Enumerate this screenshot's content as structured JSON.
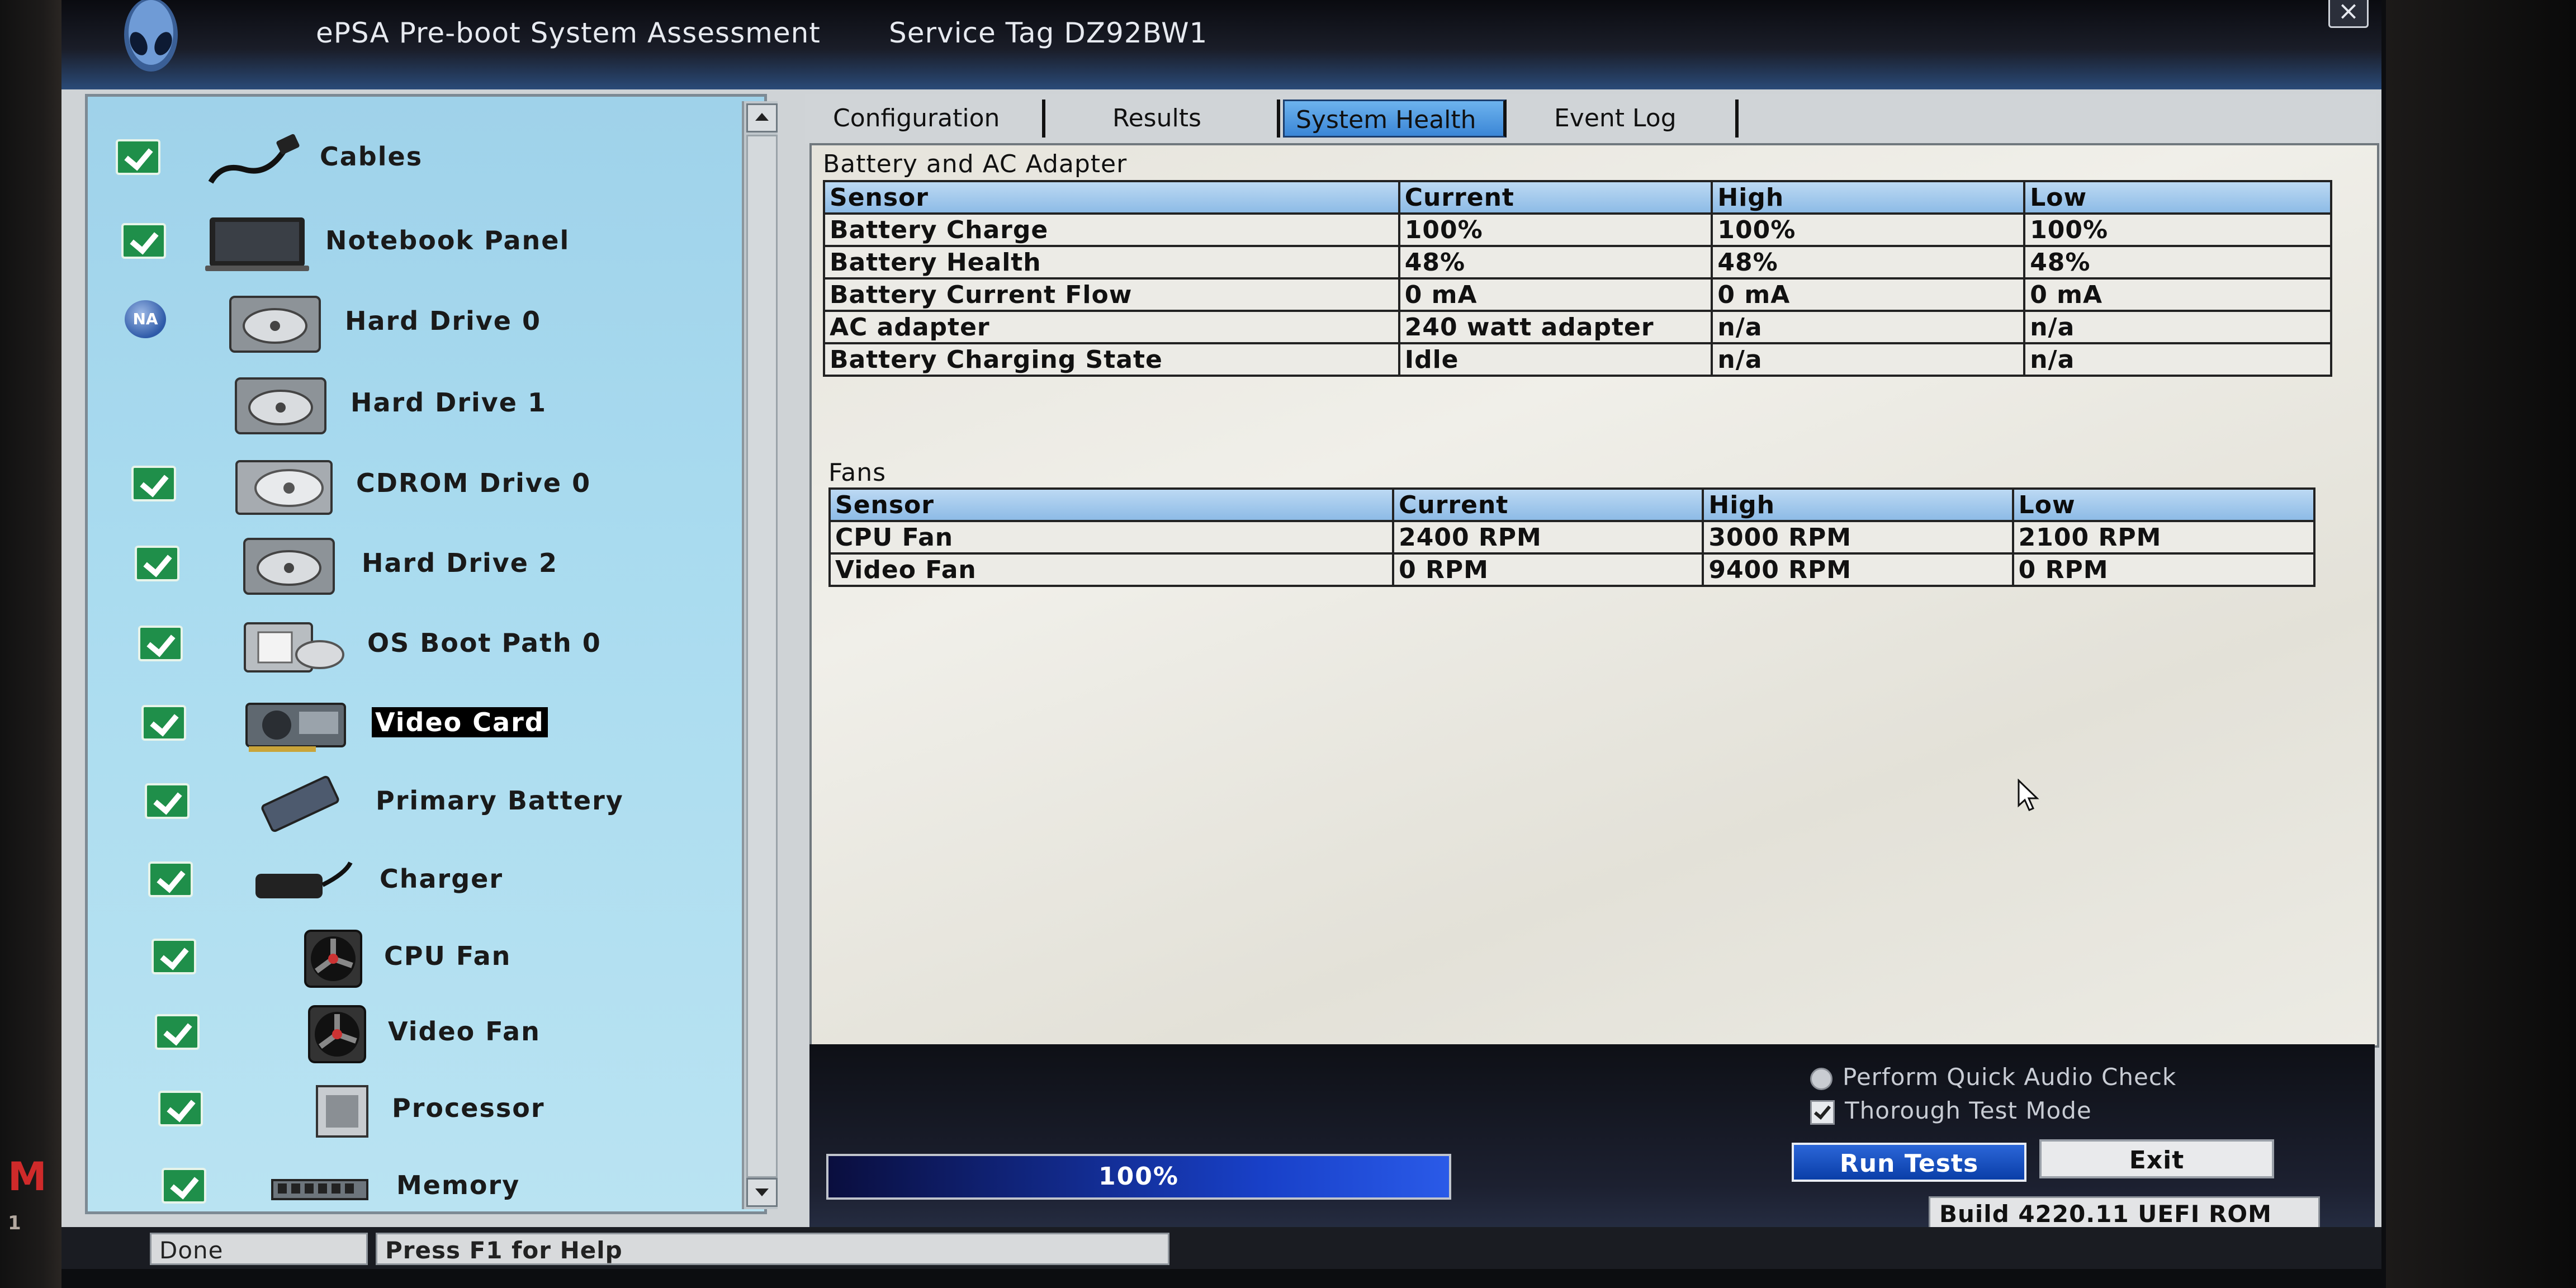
{
  "window": {
    "title": "ePSA Pre-boot System Assessment",
    "service_tag": "Service Tag DZ92BW1",
    "close_label": "×"
  },
  "edge_text": {
    "letter": "M",
    "number": "1"
  },
  "devices": [
    {
      "label": "Cables",
      "status": "passed",
      "icon": "cable-icon"
    },
    {
      "label": "Notebook Panel",
      "status": "passed",
      "icon": "laptop-panel-icon"
    },
    {
      "label": "Hard Drive 0",
      "status": "not-applicable",
      "badge": "NA",
      "icon": "hard-drive-icon"
    },
    {
      "label": "Hard Drive 1",
      "status": "none",
      "icon": "hard-drive-icon"
    },
    {
      "label": "CDROM Drive 0",
      "status": "passed",
      "icon": "cdrom-icon"
    },
    {
      "label": "Hard Drive 2",
      "status": "passed",
      "icon": "hard-drive-icon"
    },
    {
      "label": "OS Boot Path 0",
      "status": "passed",
      "icon": "boot-path-icon"
    },
    {
      "label": "Video Card",
      "status": "passed",
      "selected": true,
      "icon": "video-card-icon"
    },
    {
      "label": "Primary Battery",
      "status": "passed",
      "icon": "battery-icon"
    },
    {
      "label": "Charger",
      "status": "passed",
      "icon": "charger-icon"
    },
    {
      "label": "CPU Fan",
      "status": "passed",
      "icon": "fan-icon"
    },
    {
      "label": "Video Fan",
      "status": "passed",
      "icon": "fan-icon"
    },
    {
      "label": "Processor",
      "status": "passed",
      "icon": "processor-icon"
    },
    {
      "label": "Memory",
      "status": "passed",
      "icon": "memory-icon"
    }
  ],
  "tabs": [
    {
      "label": "Configuration",
      "active": false
    },
    {
      "label": "Results",
      "active": false
    },
    {
      "label": "System Health",
      "active": true
    },
    {
      "label": "Event Log",
      "active": false
    }
  ],
  "battery": {
    "title": "Battery and AC Adapter",
    "headers": [
      "Sensor",
      "Current",
      "High",
      "Low"
    ],
    "rows": [
      [
        "Battery Charge",
        "100%",
        "100%",
        "100%"
      ],
      [
        "Battery Health",
        "48%",
        "48%",
        "48%"
      ],
      [
        "Battery Current Flow",
        "0 mA",
        "0 mA",
        "0 mA"
      ],
      [
        "AC adapter",
        "240 watt adapter",
        "n/a",
        "n/a"
      ],
      [
        "Battery Charging State",
        "Idle",
        "n/a",
        "n/a"
      ]
    ]
  },
  "fans": {
    "title": "Fans",
    "headers": [
      "Sensor",
      "Current",
      "High",
      "Low"
    ],
    "rows": [
      [
        "CPU Fan",
        "2400 RPM",
        "3000 RPM",
        "2100 RPM"
      ],
      [
        "Video Fan",
        "0 RPM",
        "9400 RPM",
        "0 RPM"
      ]
    ]
  },
  "options": {
    "quick_audio": {
      "label": "Perform Quick Audio Check",
      "checked": false
    },
    "thorough": {
      "label": "Thorough Test Mode",
      "checked": true
    }
  },
  "progress": {
    "value": 1.0,
    "label": "100%"
  },
  "buttons": {
    "run": "Run Tests",
    "exit": "Exit"
  },
  "status": {
    "state": "Done",
    "help": "Press F1 for Help",
    "build": "Build  4220.11 UEFI ROM"
  },
  "colors": {
    "accent": "#3b86d6",
    "pass": "#1f8f4a",
    "panel": "#a9dbef"
  }
}
